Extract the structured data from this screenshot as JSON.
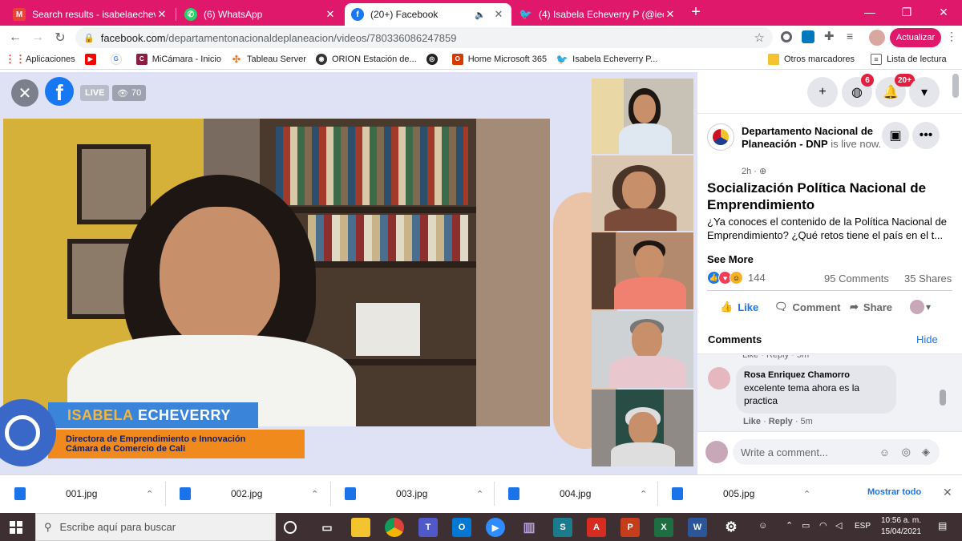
{
  "tabs": [
    {
      "title": "Search results - isabelaecheverry@",
      "icon": "gmail-icon",
      "color": "#ea4335",
      "letter": "M"
    },
    {
      "title": "(6) WhatsApp",
      "icon": "whatsapp-icon",
      "color": "#25d366",
      "letter": "W"
    },
    {
      "title": "(20+) Facebook",
      "icon": "facebook-icon",
      "color": "#1877f2",
      "letter": "f",
      "active": true
    },
    {
      "title": "(4) Isabela Echeverry P (@ieche",
      "icon": "twitter-icon",
      "color": "#1d9bf0",
      "letter": "t"
    }
  ],
  "address": {
    "host": "facebook.com",
    "path": "/departamentonacionaldeplaneacion/videos/780336086247859"
  },
  "update_label": "Actualizar",
  "bookmarks": [
    {
      "label": "Aplicaciones",
      "icon": "apps-icon",
      "color": "#4285f4"
    },
    {
      "label": "",
      "icon": "youtube-icon",
      "color": "#ff0000"
    },
    {
      "label": "",
      "icon": "google-icon",
      "color": "#4285f4"
    },
    {
      "label": "MiCámara - Inicio",
      "icon": "micamara-icon",
      "color": "#8b1d41"
    },
    {
      "label": "Tableau Server",
      "icon": "tableau-icon",
      "color": "#e97627"
    },
    {
      "label": "ORION Estación de...",
      "icon": "orion-icon",
      "color": "#333333"
    },
    {
      "label": "",
      "icon": "github-icon",
      "color": "#222222"
    },
    {
      "label": "Home Microsoft 365",
      "icon": "office-icon",
      "color": "#d83b01"
    },
    {
      "label": "Isabela Echeverry P...",
      "icon": "twitter-icon",
      "color": "#1d9bf0"
    }
  ],
  "bookmarks_right": {
    "other": "Otros marcadores",
    "reading": "Lista de lectura"
  },
  "video": {
    "live_label": "LIVE",
    "viewer_count": "70",
    "presenter_first": "ISABELA",
    "presenter_last": "ECHEVERRY",
    "presenter_role_1": "Directora de Emprendimiento e Innovación",
    "presenter_role_2": "Cámara de Comercio de Cali"
  },
  "fb": {
    "messenger_badge": "6",
    "notif_badge": "20+",
    "page_name": "Departamento Nacional de Planeación - DNP",
    "live_text": " is live now.",
    "time": "2h",
    "post_title": "Socialización Política Nacional de Emprendimiento",
    "post_body": "¿Ya conoces el contenido de la Política Nacional de Emprendimiento? ¿Qué retos tiene el país en el t...",
    "see_more": "See More",
    "reactions_count": "144",
    "comments_count": "95 Comments",
    "shares_count": "35 Shares",
    "like_label": "Like",
    "comment_label": "Comment",
    "share_label": "Share",
    "comments_header": "Comments",
    "hide_label": "Hide",
    "prev_comment_meta": "Like · Reply · 5m",
    "comment": {
      "author": "Rosa Enriquez Chamorro",
      "text": "excelente tema ahora es la practica",
      "like": "Like",
      "reply": "Reply",
      "time": "5m"
    },
    "write_placeholder": "Write a comment..."
  },
  "downloads": {
    "files": [
      "001.jpg",
      "002.jpg",
      "003.jpg",
      "004.jpg",
      "005.jpg"
    ],
    "show_all": "Mostrar todo"
  },
  "taskbar": {
    "search_placeholder": "Escribe aquí para buscar",
    "lang": "ESP",
    "time": "10:56 a. m.",
    "date": "15/04/2021"
  }
}
